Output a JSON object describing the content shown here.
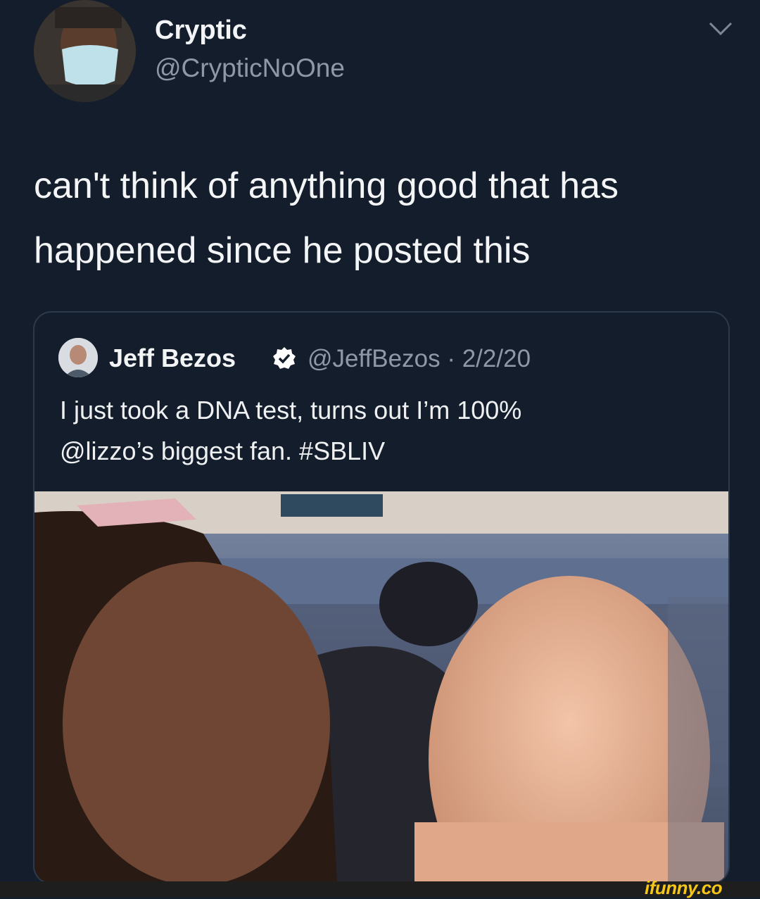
{
  "tweet": {
    "author_name": "Cryptic",
    "author_handle": "@CrypticNoOne",
    "text_line1": "can't think of anything good that has",
    "text_line2": "happened since he posted this"
  },
  "quoted_tweet": {
    "author_name": "Jeff Bezos",
    "author_handle": "@JeffBezos",
    "separator": "·",
    "date": "2/2/20",
    "text_line1": "I just took a DNA test, turns out I’m 100%",
    "text_line2": "@lizzo’s biggest fan. #SBLIV"
  },
  "watermark": "ifunny.co",
  "icons": {
    "menu": "chevron-down-icon",
    "verified": "verified-badge-icon"
  },
  "colors": {
    "background": "#141d2b",
    "secondary_text": "#8e99a8",
    "verified": "#ffffff",
    "watermark": "#f5c518"
  }
}
